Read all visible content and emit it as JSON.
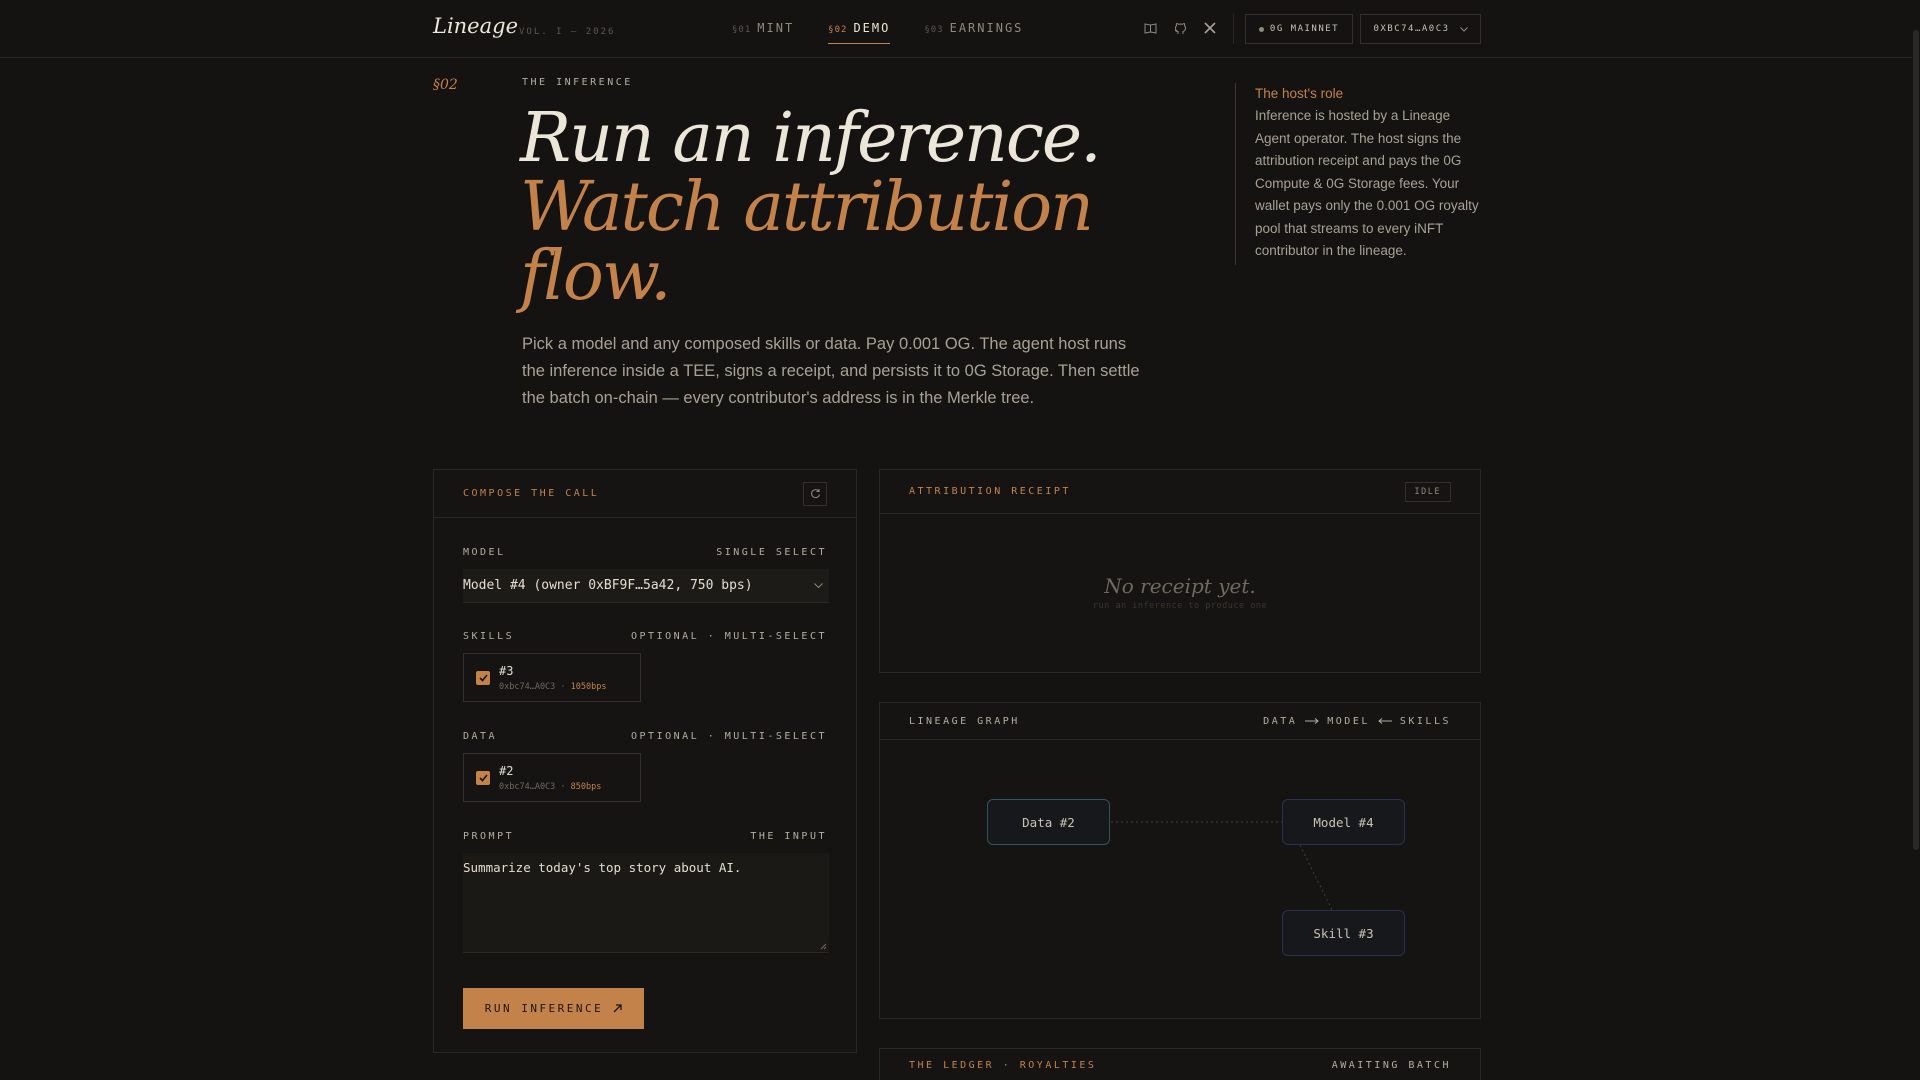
{
  "header": {
    "brand": "Lineage",
    "volume": "VOL. I — 2026",
    "nav": [
      {
        "sec": "§01",
        "label": "MINT"
      },
      {
        "sec": "§02",
        "label": "DEMO"
      },
      {
        "sec": "§03",
        "label": "EARNINGS"
      }
    ],
    "icons": [
      "book-icon",
      "github-icon",
      "x-icon"
    ],
    "network_label": "0G MAINNET",
    "wallet_label": "0XBC74…A0C3"
  },
  "hero": {
    "section_number": "§02",
    "eyebrow": "THE INFERENCE",
    "title_line1": "Run an inference.",
    "title_line2": "Watch attribution flow.",
    "description": "Pick a model and any composed skills or data. Pay 0.001 OG. The agent host runs the inference inside a TEE, signs a receipt, and persists it to 0G Storage. Then settle the batch on-chain — every contributor's address is in the Merkle tree."
  },
  "host_role": {
    "title": "The host's role",
    "text": "Inference is hosted by a Lineage Agent operator. The host signs the attribution receipt and pays the 0G Compute & 0G Storage fees. Your wallet pays only the 0.001 OG royalty pool that streams to every iNFT contributor in the lineage."
  },
  "compose": {
    "title": "COMPOSE THE CALL",
    "model_label": "MODEL",
    "model_hint": "SINGLE SELECT",
    "model_value": "Model #4 (owner 0xBF9F…5a42, 750 bps)",
    "skills_label": "SKILLS",
    "skills_hint": "OPTIONAL · MULTI-SELECT",
    "skill_item": {
      "id": "#3",
      "owner": "0xbc74…A0C3",
      "bps": "1050bps"
    },
    "data_label": "DATA",
    "data_hint": "OPTIONAL · MULTI-SELECT",
    "data_item": {
      "id": "#2",
      "owner": "0xbc74…A0C3",
      "bps": "850bps"
    },
    "prompt_label": "PROMPT",
    "prompt_hint": "THE INPUT",
    "prompt_value": "Summarize today's top story about AI.",
    "run_label": "RUN INFERENCE"
  },
  "receipt": {
    "title": "ATTRIBUTION RECEIPT",
    "status": "IDLE",
    "empty_title": "No receipt yet.",
    "empty_sub": "run an inference to produce one"
  },
  "graph": {
    "title": "LINEAGE GRAPH",
    "legend": {
      "a": "DATA",
      "b": "MODEL",
      "c": "SKILLS"
    },
    "nodes": {
      "data": "Data #2",
      "model": "Model #4",
      "skill": "Skill #3"
    }
  },
  "ledger": {
    "title": "THE LEDGER · ROYALTIES",
    "status": "AWAITING BATCH"
  },
  "colors": {
    "background": "#141311",
    "accent": "#c4824b",
    "text": "#ece6d8"
  }
}
